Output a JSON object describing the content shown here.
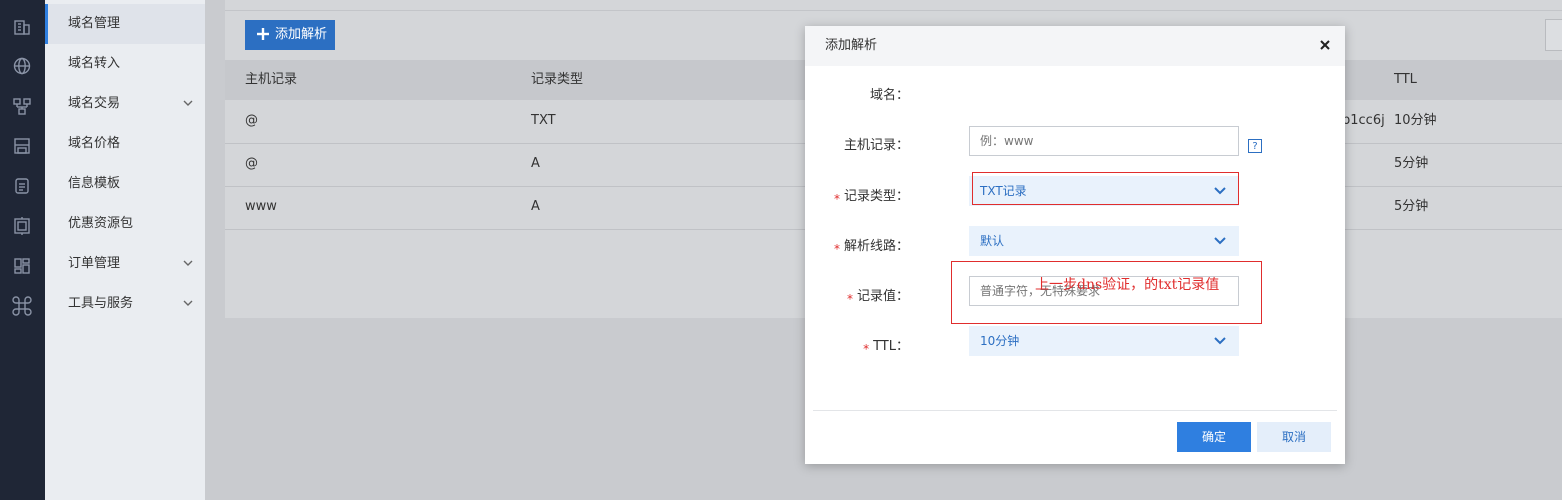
{
  "rail": {
    "icons": [
      "building-icon",
      "globe-icon",
      "network-icon",
      "save-icon",
      "document-icon",
      "server-icon",
      "dashboard-icon",
      "command-icon"
    ]
  },
  "nav": {
    "items": [
      {
        "label": "域名管理",
        "active": true,
        "expandable": false
      },
      {
        "label": "域名转入",
        "active": false,
        "expandable": false
      },
      {
        "label": "域名交易",
        "active": false,
        "expandable": true
      },
      {
        "label": "域名价格",
        "active": false,
        "expandable": false
      },
      {
        "label": "信息模板",
        "active": false,
        "expandable": false
      },
      {
        "label": "优惠资源包",
        "active": false,
        "expandable": false
      },
      {
        "label": "订单管理",
        "active": false,
        "expandable": true
      },
      {
        "label": "工具与服务",
        "active": false,
        "expandable": true
      }
    ]
  },
  "toolbar": {
    "add_label": "添加解析"
  },
  "table": {
    "headers": {
      "host": "主机记录",
      "type": "记录类型",
      "ttl": "TTL"
    },
    "rows": [
      {
        "host": "@",
        "type": "TXT",
        "value_tail": "p1cc6j",
        "ttl": "10分钟"
      },
      {
        "host": "@",
        "type": "A",
        "value_tail": "",
        "ttl": "5分钟"
      },
      {
        "host": "www",
        "type": "A",
        "value_tail": "",
        "ttl": "5分钟"
      }
    ]
  },
  "modal": {
    "title": "添加解析",
    "close_icon": "close-icon",
    "domain_label": "域名：",
    "domain_value": "",
    "host_label": "主机记录：",
    "host_placeholder": "例：www",
    "help_text": "?",
    "type_label": "记录类型：",
    "type_value": "TXT记录",
    "line_label": "解析线路：",
    "line_value": "默认",
    "value_label": "记录值：",
    "value_placeholder": "普通字符，无特殊要求",
    "ttl_label": "TTL：",
    "ttl_value": "10分钟",
    "required_mark": "*",
    "ok_label": "确定",
    "cancel_label": "取消"
  },
  "annotation": {
    "text": "上一步dns验证，的txt记录值",
    "color": "#e02d2d"
  },
  "colors": {
    "accent": "#2f7fe0",
    "rail": "#1f2636",
    "annotation": "#e02d2d"
  }
}
